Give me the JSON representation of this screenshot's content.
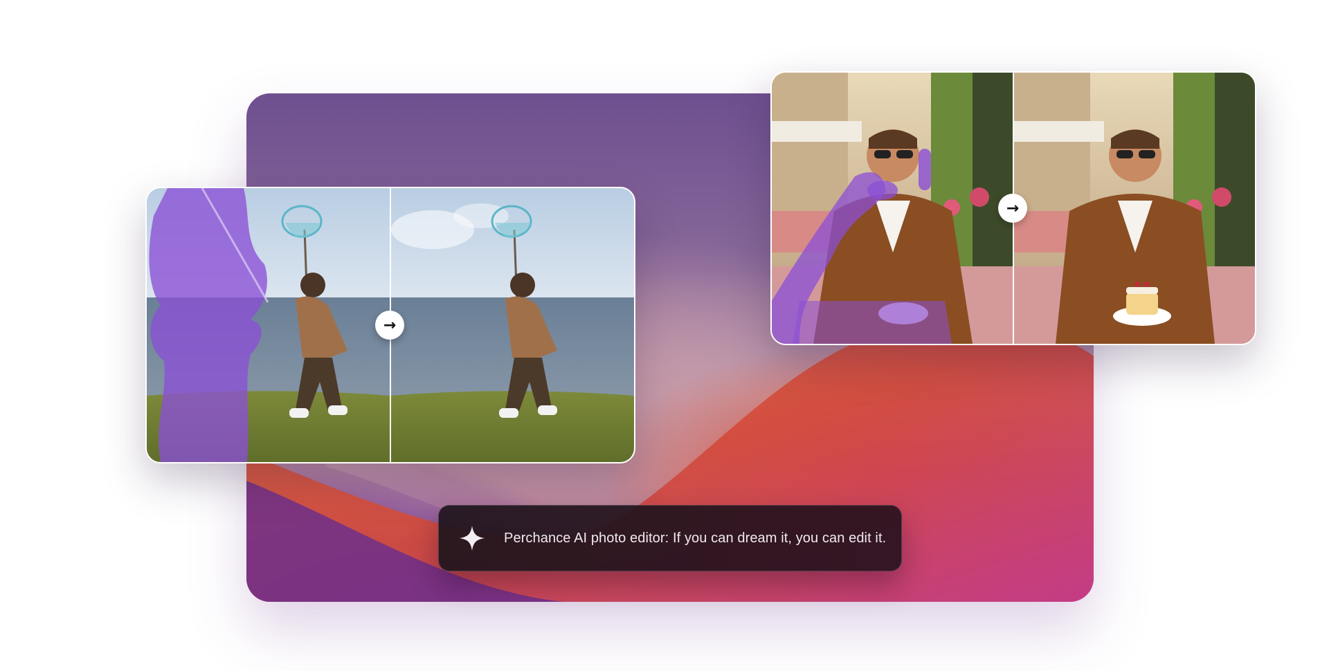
{
  "prompt": {
    "icon": "sparkle-icon",
    "text": "Perchance AI photo editor: If you can dream it, you can edit it."
  },
  "examples": [
    {
      "id": "beach-remove",
      "icon": "arrow-right-icon",
      "arrow": "→"
    },
    {
      "id": "cafe-edit",
      "icon": "arrow-right-icon",
      "arrow": "→"
    }
  ],
  "colors": {
    "mask": "#8b4fd6",
    "accent": "#6e4f8f"
  }
}
